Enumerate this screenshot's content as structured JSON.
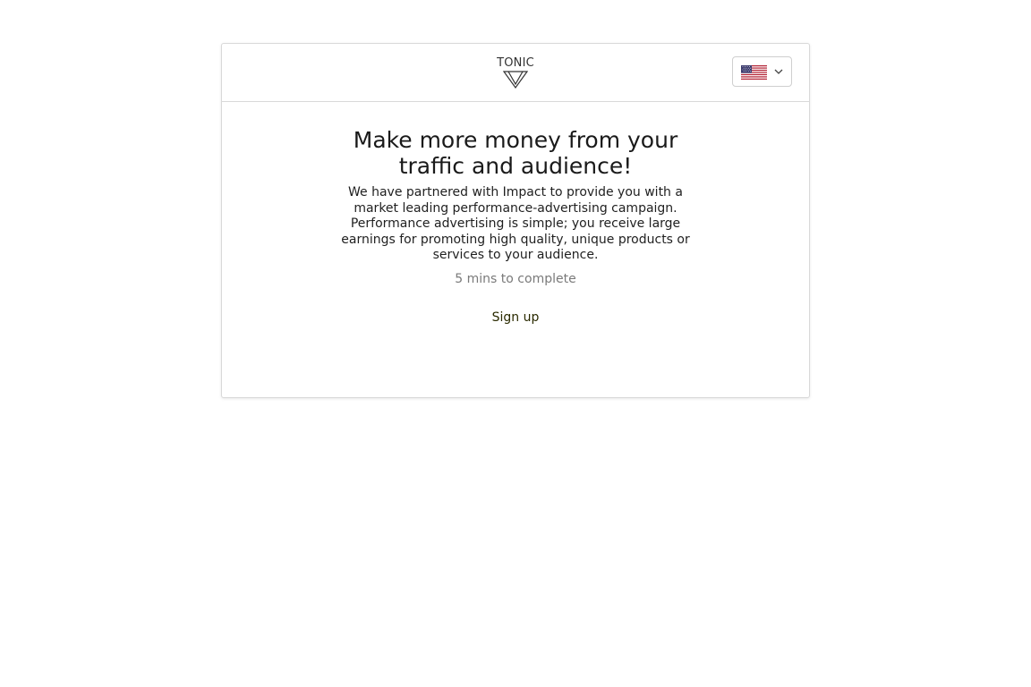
{
  "header": {
    "logo_text": "TONIC",
    "language_flag_icon": "us-flag-icon",
    "dropdown_icon": "chevron-down-icon"
  },
  "main": {
    "headline": "Make more money from your traffic and audience!",
    "description": "We have partnered with Impact to provide you with a market leading performance-advertising campaign. Performance advertising is simple; you receive large earnings for promoting high quality, unique products or services to your audience.",
    "duration": "5 mins to complete",
    "signup_label": "Sign up"
  },
  "colors": {
    "flag_red": "#B22234",
    "flag_blue": "#3C3B6E",
    "border": "#d9d9d9",
    "muted_text": "#7a7a7a"
  }
}
